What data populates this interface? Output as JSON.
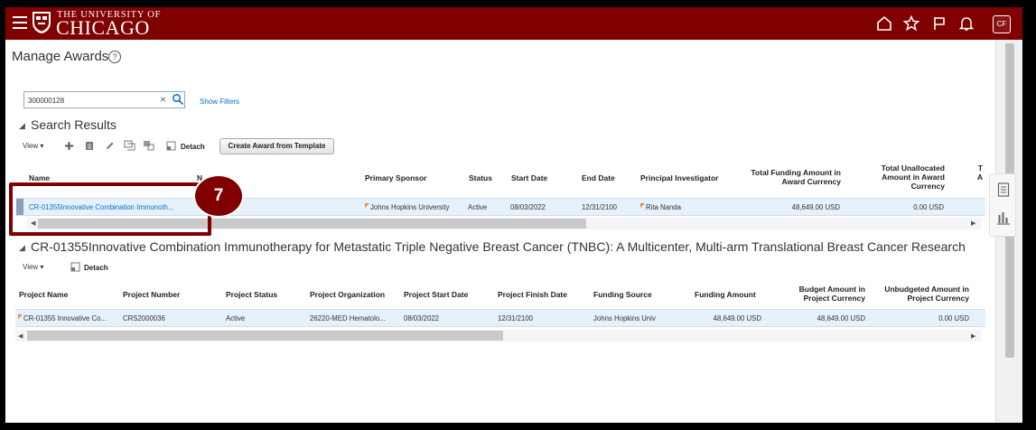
{
  "header": {
    "university_line1": "THE UNIVERSITY OF",
    "university_line2": "CHICAGO",
    "avatar_initials": "CF",
    "brand_color": "#800000",
    "icons": [
      "menu-icon",
      "home-icon",
      "star-icon",
      "flag-icon",
      "bell-icon"
    ]
  },
  "page": {
    "title": "Manage Awards",
    "help_glyph": "?"
  },
  "search": {
    "value": "300000128",
    "show_filters": "Show Filters"
  },
  "results": {
    "title": "Search Results",
    "toolbar": {
      "view": "View",
      "detach": "Detach",
      "create_template": "Create Award from Template"
    },
    "columns": {
      "name": "Name",
      "number": "N",
      "primary_sponsor": "Primary Sponsor",
      "status": "Status",
      "start_date": "Start Date",
      "end_date": "End Date",
      "pi": "Principal Investigator",
      "total_funding": "Total Funding Amount in Award Currency",
      "total_unallocated": "Total Unallocated Amount in Award Currency",
      "truncated": "T A"
    },
    "row": {
      "name": "CR-01355Innovative Combination Immunoth...",
      "primary_sponsor": "Johns Hopkins University",
      "status": "Active",
      "start_date": "08/03/2022",
      "end_date": "12/31/2100",
      "pi": "Rita Nanda",
      "total_funding": "48,649.00 USD",
      "total_unallocated": "0.00 USD"
    }
  },
  "callout": {
    "number": "7"
  },
  "award_detail": {
    "title": "CR-01355Innovative Combination Immunotherapy for Metastatic Triple Negative Breast Cancer (TNBC): A Multicenter, Multi-arm Translational Breast Cancer Research",
    "toolbar": {
      "view": "View",
      "detach": "Detach"
    },
    "columns": {
      "project_name": "Project Name",
      "project_number": "Project Number",
      "project_status": "Project Status",
      "project_org": "Project Organization",
      "project_start": "Project Start Date",
      "project_finish": "Project Finish Date",
      "funding_source": "Funding Source",
      "funding_amount": "Funding Amount",
      "budget_amount": "Budget Amount in Project Currency",
      "unbudgeted_amount": "Unbudgeted Amount in Project Currency"
    },
    "row": {
      "project_name": "CR-01355 Innovative Co...",
      "project_number": "CRS2000036",
      "project_status": "Active",
      "project_org": "26220-MED Hematolo...",
      "project_start": "08/03/2022",
      "project_finish": "12/31/2100",
      "funding_source": "Johns Hopkins Univ",
      "funding_amount": "48,649.00 USD",
      "budget_amount": "48,649.00 USD",
      "unbudgeted_amount": "0.00 USD"
    }
  }
}
